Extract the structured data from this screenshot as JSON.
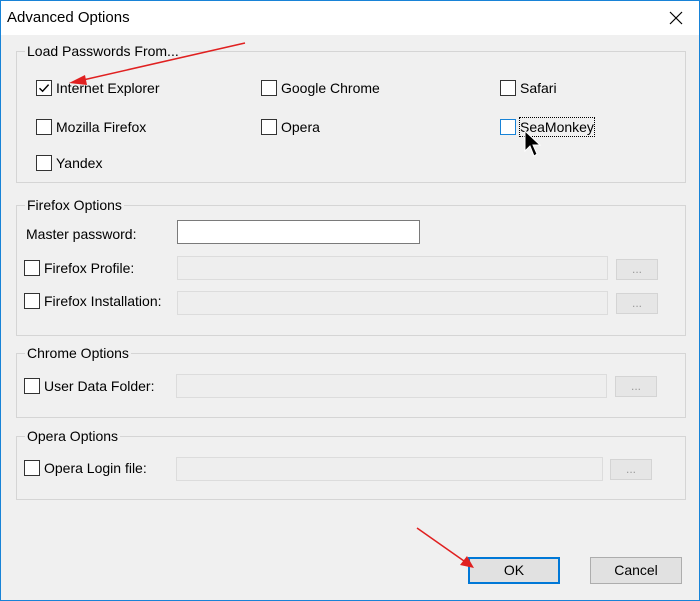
{
  "window": {
    "title": "Advanced Options"
  },
  "load_passwords": {
    "legend": "Load Passwords From...",
    "options": [
      {
        "label": "Internet Explorer",
        "checked": true
      },
      {
        "label": "Google Chrome",
        "checked": false
      },
      {
        "label": "Safari",
        "checked": false
      },
      {
        "label": "Mozilla Firefox",
        "checked": false
      },
      {
        "label": "Opera",
        "checked": false
      },
      {
        "label": "SeaMonkey",
        "checked": false,
        "focused": true
      },
      {
        "label": "Yandex",
        "checked": false
      }
    ]
  },
  "firefox": {
    "legend": "Firefox Options",
    "master_password_label": "Master password:",
    "master_password_value": "",
    "profile_label": "Firefox Profile:",
    "profile_value": "",
    "installation_label": "Firefox Installation:",
    "installation_value": "",
    "browse_label": "..."
  },
  "chrome": {
    "legend": "Chrome Options",
    "user_data_label": "User Data Folder:",
    "user_data_value": "",
    "browse_label": "..."
  },
  "opera": {
    "legend": "Opera Options",
    "login_file_label": "Opera Login file:",
    "login_file_value": "",
    "browse_label": "..."
  },
  "buttons": {
    "ok": "OK",
    "cancel": "Cancel"
  },
  "colors": {
    "accent": "#0078d7",
    "annotation_arrow": "#e02020"
  }
}
